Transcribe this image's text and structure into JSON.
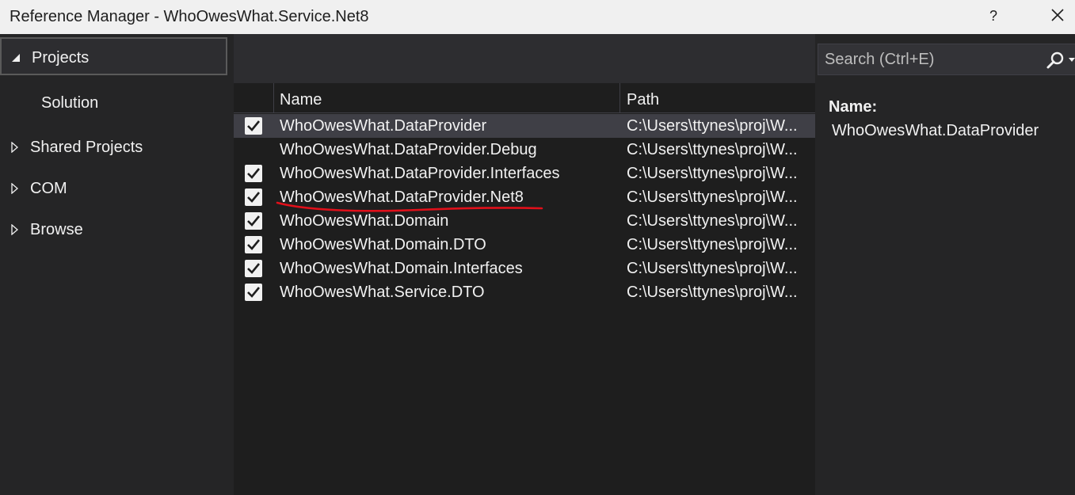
{
  "window": {
    "title": "Reference Manager - WhoOwesWhat.Service.Net8",
    "help_label": "?"
  },
  "sidebar": {
    "items": [
      {
        "label": "Projects",
        "expanded": true,
        "selected": true
      },
      {
        "label": "Solution",
        "child": true
      },
      {
        "label": "Shared Projects",
        "expanded": false
      },
      {
        "label": "COM",
        "expanded": false
      },
      {
        "label": "Browse",
        "expanded": false
      }
    ]
  },
  "grid": {
    "columns": {
      "name": "Name",
      "path": "Path"
    },
    "rows": [
      {
        "checked": true,
        "name": "WhoOwesWhat.DataProvider",
        "path": "C:\\Users\\ttynes\\proj\\W...",
        "selected": true
      },
      {
        "checked": false,
        "name": "WhoOwesWhat.DataProvider.Debug",
        "path": "C:\\Users\\ttynes\\proj\\W..."
      },
      {
        "checked": true,
        "name": "WhoOwesWhat.DataProvider.Interfaces",
        "path": "C:\\Users\\ttynes\\proj\\W..."
      },
      {
        "checked": true,
        "name": "WhoOwesWhat.DataProvider.Net8",
        "path": "C:\\Users\\ttynes\\proj\\W...",
        "annotated": true
      },
      {
        "checked": true,
        "name": "WhoOwesWhat.Domain",
        "path": "C:\\Users\\ttynes\\proj\\W..."
      },
      {
        "checked": true,
        "name": "WhoOwesWhat.Domain.DTO",
        "path": "C:\\Users\\ttynes\\proj\\W..."
      },
      {
        "checked": true,
        "name": "WhoOwesWhat.Domain.Interfaces",
        "path": "C:\\Users\\ttynes\\proj\\W..."
      },
      {
        "checked": true,
        "name": "WhoOwesWhat.Service.DTO",
        "path": "C:\\Users\\ttynes\\proj\\W..."
      }
    ]
  },
  "search": {
    "placeholder": "Search (Ctrl+E)",
    "value": ""
  },
  "details": {
    "name_label": "Name:",
    "name_value": "WhoOwesWhat.DataProvider"
  },
  "colors": {
    "annotation": "#e0101a",
    "checkbox": "#f1f1f1",
    "selected_row": "#3f3f46"
  },
  "icons": {
    "expanded": "triangle-down-icon",
    "collapsed": "chevron-right-icon",
    "search": "search-icon",
    "close": "close-icon",
    "check": "check-icon"
  }
}
